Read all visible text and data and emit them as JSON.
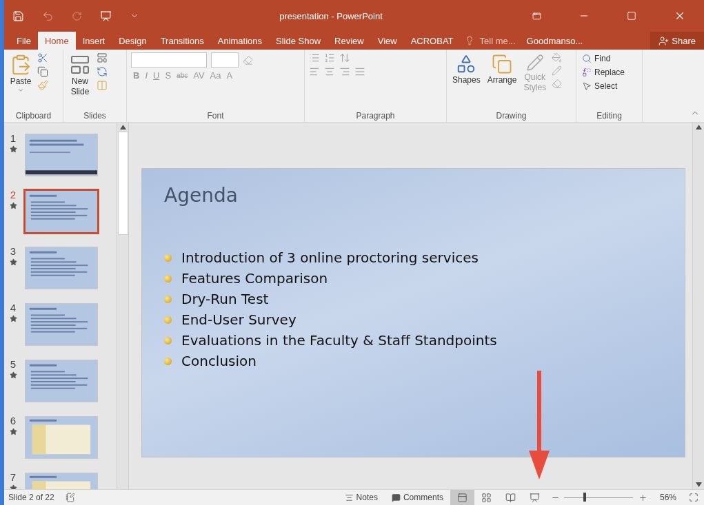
{
  "window": {
    "title": "presentation - PowerPoint"
  },
  "tabs": [
    {
      "label": "File",
      "selected": false
    },
    {
      "label": "Home",
      "selected": true
    },
    {
      "label": "Insert",
      "selected": false
    },
    {
      "label": "Design",
      "selected": false
    },
    {
      "label": "Transitions",
      "selected": false
    },
    {
      "label": "Animations",
      "selected": false
    },
    {
      "label": "Slide Show",
      "selected": false
    },
    {
      "label": "Review",
      "selected": false
    },
    {
      "label": "View",
      "selected": false
    },
    {
      "label": "ACROBAT",
      "selected": false
    }
  ],
  "tell_me": "Tell me...",
  "user": "Goodmanso...",
  "share": "Share",
  "ribbon": {
    "clipboard": {
      "paste": "Paste",
      "label": "Clipboard"
    },
    "slides": {
      "new_slide": [
        "New",
        "Slide"
      ],
      "label": "Slides"
    },
    "font": {
      "format_buttons": [
        "B",
        "I",
        "U",
        "S",
        "abc",
        "AV",
        "Aa",
        "A"
      ],
      "label": "Font"
    },
    "paragraph": {
      "label": "Paragraph"
    },
    "drawing": {
      "buttons": [
        "Shapes",
        "Arrange"
      ],
      "quick_styles": [
        "Quick",
        "Styles"
      ],
      "label": "Drawing"
    },
    "editing": {
      "buttons": [
        "Find",
        "Replace",
        "Select"
      ],
      "label": "Editing"
    }
  },
  "slides": [
    {
      "number": "1",
      "selected": false,
      "kind": "title"
    },
    {
      "number": "2",
      "selected": true,
      "kind": "bullets"
    },
    {
      "number": "3",
      "selected": false,
      "kind": "bullets"
    },
    {
      "number": "4",
      "selected": false,
      "kind": "bullets"
    },
    {
      "number": "5",
      "selected": false,
      "kind": "bullets"
    },
    {
      "number": "6",
      "selected": false,
      "kind": "table"
    },
    {
      "number": "7",
      "selected": false,
      "kind": "table"
    }
  ],
  "slide": {
    "title": "Agenda",
    "bullets": [
      "Introduction of 3 online proctoring services",
      "Features Comparison",
      "Dry-Run Test",
      "End-User Survey",
      "Evaluations in the Faculty & Staff Standpoints",
      "Conclusion"
    ]
  },
  "status_bar": {
    "slide_count": "Slide 2 of 22",
    "notes": "Notes",
    "comments": "Comments",
    "views": [
      {
        "kind": "normal",
        "selected": true
      },
      {
        "kind": "sorter",
        "selected": false
      },
      {
        "kind": "reading",
        "selected": false
      },
      {
        "kind": "slideshow",
        "selected": false
      }
    ],
    "zoom": {
      "level": 0.3,
      "reading": "56%"
    }
  }
}
